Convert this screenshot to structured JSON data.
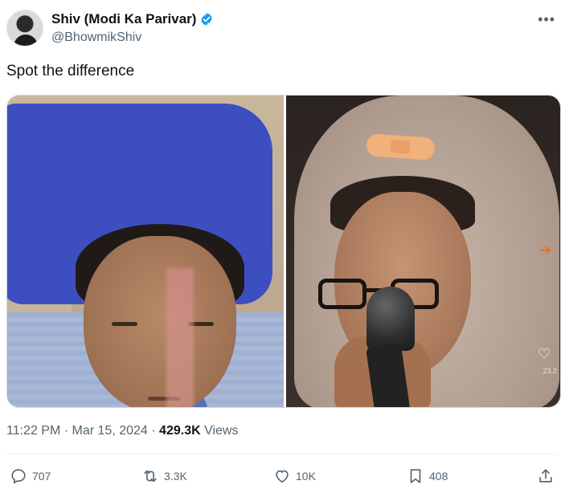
{
  "author": {
    "display_name": "Shiv (Modi Ka Parivar)",
    "handle": "@BhowmikShiv",
    "verified_color": "#1d9bf0"
  },
  "tweet": {
    "text": "Spot the difference"
  },
  "media": {
    "left_image_alt": "Photo of a woman lying on a pillow in a hospital bed",
    "right_image_alt": "Photo of a woman with a bandage on her forehead speaking into a microphone",
    "right_overlay_count": "23.2"
  },
  "meta": {
    "time": "11:22 PM",
    "separator": "·",
    "date": "Mar 15, 2024",
    "views_count": "429.3K",
    "views_label": "Views"
  },
  "actions": {
    "replies": "707",
    "retweets": "3.3K",
    "likes": "10K",
    "bookmarks": "408"
  },
  "icons": {
    "more": "more-icon",
    "reply": "reply-icon",
    "retweet": "retweet-icon",
    "like": "heart-icon",
    "bookmark": "bookmark-icon",
    "share": "share-icon"
  }
}
